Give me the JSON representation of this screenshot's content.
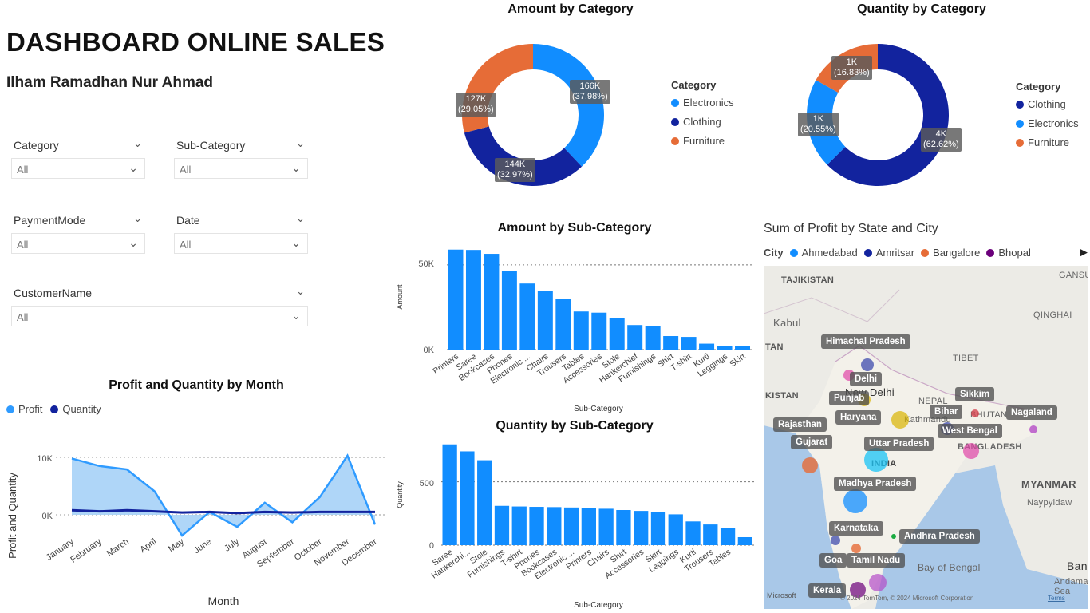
{
  "header": {
    "title": "DASHBOARD ONLINE SALES",
    "author": "Ilham Ramadhan Nur Ahmad"
  },
  "slicers": [
    {
      "label": "Category",
      "value": "All"
    },
    {
      "label": "Sub-Category",
      "value": "All"
    },
    {
      "label": "PaymentMode",
      "value": "All"
    },
    {
      "label": "Date",
      "value": "All"
    },
    {
      "label": "CustomerName",
      "value": "All"
    }
  ],
  "colors": {
    "electronics": "#118DFF",
    "clothing": "#12239E",
    "furniture": "#E66C37",
    "bar": "#118DFF",
    "profit": "#2F9BFF",
    "profit_fill": "#A6D2F7",
    "quantity": "#12239E"
  },
  "donut_amount": {
    "title": "Amount by Category",
    "legend_title": "Category",
    "legend": [
      "Electronics",
      "Clothing",
      "Furniture"
    ],
    "labels": [
      {
        "value": "166K",
        "pct": "(37.98%)"
      },
      {
        "value": "144K",
        "pct": "(32.97%)"
      },
      {
        "value": "127K",
        "pct": "(29.05%)"
      }
    ]
  },
  "donut_quantity": {
    "title": "Quantity by Category",
    "legend_title": "Category",
    "legend": [
      "Clothing",
      "Electronics",
      "Furniture"
    ],
    "labels": [
      {
        "value": "4K",
        "pct": "(62.62%)"
      },
      {
        "value": "1K",
        "pct": "(20.55%)"
      },
      {
        "value": "1K",
        "pct": "(16.83%)"
      }
    ]
  },
  "line_chart": {
    "title": "Profit and Quantity by Month",
    "legend": [
      "Profit",
      "Quantity"
    ],
    "ylabel": "Profit and Quantity",
    "xlabel": "Month",
    "yticks": [
      "10K",
      "0K"
    ]
  },
  "bar_amount": {
    "title": "Amount by Sub-Category",
    "ylabel": "Amount",
    "xlabel": "Sub-Category",
    "yticks": [
      "50K",
      "0K"
    ]
  },
  "bar_quantity": {
    "title": "Quantity by Sub-Category",
    "ylabel": "Quantity",
    "xlabel": "Sub-Category",
    "yticks": [
      "500",
      "0"
    ]
  },
  "map": {
    "title": "Sum of Profit by State and City",
    "legend_title": "City",
    "legend": [
      {
        "name": "Ahmedabad",
        "color": "#118DFF"
      },
      {
        "name": "Amritsar",
        "color": "#12239E"
      },
      {
        "name": "Bangalore",
        "color": "#E66C37"
      },
      {
        "name": "Bhopal",
        "color": "#6B007B"
      }
    ],
    "places": [
      "TAJIKISTAN",
      "Kabul",
      "TAN",
      "KISTAN",
      "NEPAL",
      "BHUTAN",
      "BANGLADESH",
      "INDIA",
      "MYANMAR",
      "Naypyidaw",
      "Bay of Bengal",
      "Andaman Sea",
      "GANSU",
      "QINGHAI",
      "TIBET",
      "Kathmandu",
      "New Delhi",
      "Ban"
    ],
    "states": [
      "Himachal Pradesh",
      "Delhi",
      "Punjab",
      "Haryana",
      "Rajasthan",
      "Gujarat",
      "Uttar Pradesh",
      "Madhya Pradesh",
      "Sikkim",
      "Bihar",
      "West Bengal",
      "Nagaland",
      "Karnataka",
      "Andhra Pradesh",
      "Goa",
      "Tamil Nadu",
      "Kerala"
    ],
    "attribution": "© 2024 TomTom, © 2024 Microsoft Corporation",
    "microsoft": "Microsoft",
    "terms": "Terms"
  },
  "chart_data": [
    {
      "type": "pie",
      "title": "Amount by Category",
      "categories": [
        "Electronics",
        "Clothing",
        "Furniture"
      ],
      "values": [
        166,
        144,
        127
      ],
      "percent": [
        37.98,
        32.97,
        29.05
      ],
      "unit": "K"
    },
    {
      "type": "pie",
      "title": "Quantity by Category",
      "categories": [
        "Clothing",
        "Electronics",
        "Furniture"
      ],
      "values": [
        4,
        1,
        1
      ],
      "percent": [
        62.62,
        20.55,
        16.83
      ],
      "unit": "K"
    },
    {
      "type": "bar",
      "title": "Amount by Sub-Category",
      "xlabel": "Sub-Category",
      "ylabel": "Amount",
      "ylim": [
        0,
        65000
      ],
      "categories": [
        "Printers",
        "Saree",
        "Bookcases",
        "Phones",
        "Electronic ...",
        "Chairs",
        "Trousers",
        "Tables",
        "Accessories",
        "Stole",
        "Hankerchief",
        "Furnishings",
        "Shirt",
        "T-shirt",
        "Kurti",
        "Leggings",
        "Skirt"
      ],
      "values": [
        59000,
        58800,
        56500,
        46500,
        39000,
        34500,
        30000,
        22500,
        21800,
        18500,
        14500,
        13800,
        8000,
        7500,
        3500,
        2300,
        2000
      ]
    },
    {
      "type": "bar",
      "title": "Quantity by Sub-Category",
      "xlabel": "Sub-Category",
      "ylabel": "Quantity",
      "ylim": [
        0,
        850
      ],
      "categories": [
        "Saree",
        "Hankerchi...",
        "Stole",
        "Furnishings",
        "T-shirt",
        "Phones",
        "Bookcases",
        "Electronic ...",
        "Printers",
        "Chairs",
        "Shirt",
        "Accessories",
        "Skirt",
        "Leggings",
        "Kurti",
        "Trousers",
        "Tables"
      ],
      "values": [
        795,
        740,
        670,
        310,
        305,
        302,
        300,
        297,
        293,
        287,
        277,
        270,
        262,
        243,
        187,
        163,
        135,
        63
      ]
    },
    {
      "type": "area",
      "title": "Profit and Quantity by Month",
      "xlabel": "Month",
      "ylabel": "Profit and Quantity",
      "ylim": [
        -5000,
        12000
      ],
      "categories": [
        "January",
        "February",
        "March",
        "April",
        "May",
        "June",
        "July",
        "August",
        "September",
        "October",
        "November",
        "December"
      ],
      "series": [
        {
          "name": "Profit",
          "values": [
            9800,
            8500,
            7900,
            4100,
            -3600,
            500,
            -2100,
            2100,
            -1300,
            3100,
            10300,
            -1700
          ]
        },
        {
          "name": "Quantity",
          "values": [
            800,
            600,
            800,
            600,
            400,
            500,
            300,
            500,
            400,
            500,
            500,
            500
          ]
        }
      ]
    }
  ]
}
